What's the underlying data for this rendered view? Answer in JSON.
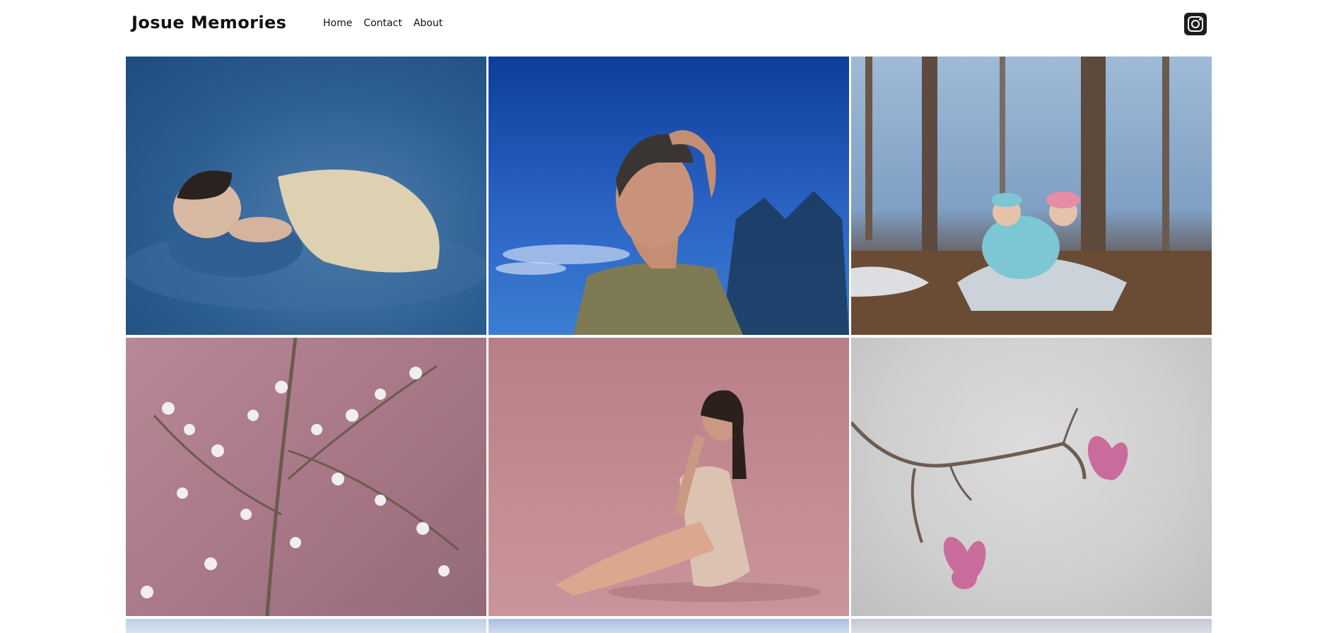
{
  "site": {
    "title": "Josue Memories"
  },
  "nav": {
    "items": [
      "Home",
      "Contact",
      "About"
    ]
  },
  "social": {
    "instagram_icon": "instagram-icon"
  },
  "gallery": {
    "photos": [
      {
        "subject": "newborn-blue"
      },
      {
        "subject": "portrait-woman-blue"
      },
      {
        "subject": "children-forest"
      },
      {
        "subject": "blossom-branch-pink"
      },
      {
        "subject": "woman-seated-pink"
      },
      {
        "subject": "magnolia-branch"
      },
      {
        "subject": "photo-7"
      },
      {
        "subject": "photo-8"
      },
      {
        "subject": "photo-9"
      }
    ]
  },
  "colors": {
    "background": "#ffffff",
    "text": "#111111",
    "icon_bg": "#1d1d1d"
  }
}
